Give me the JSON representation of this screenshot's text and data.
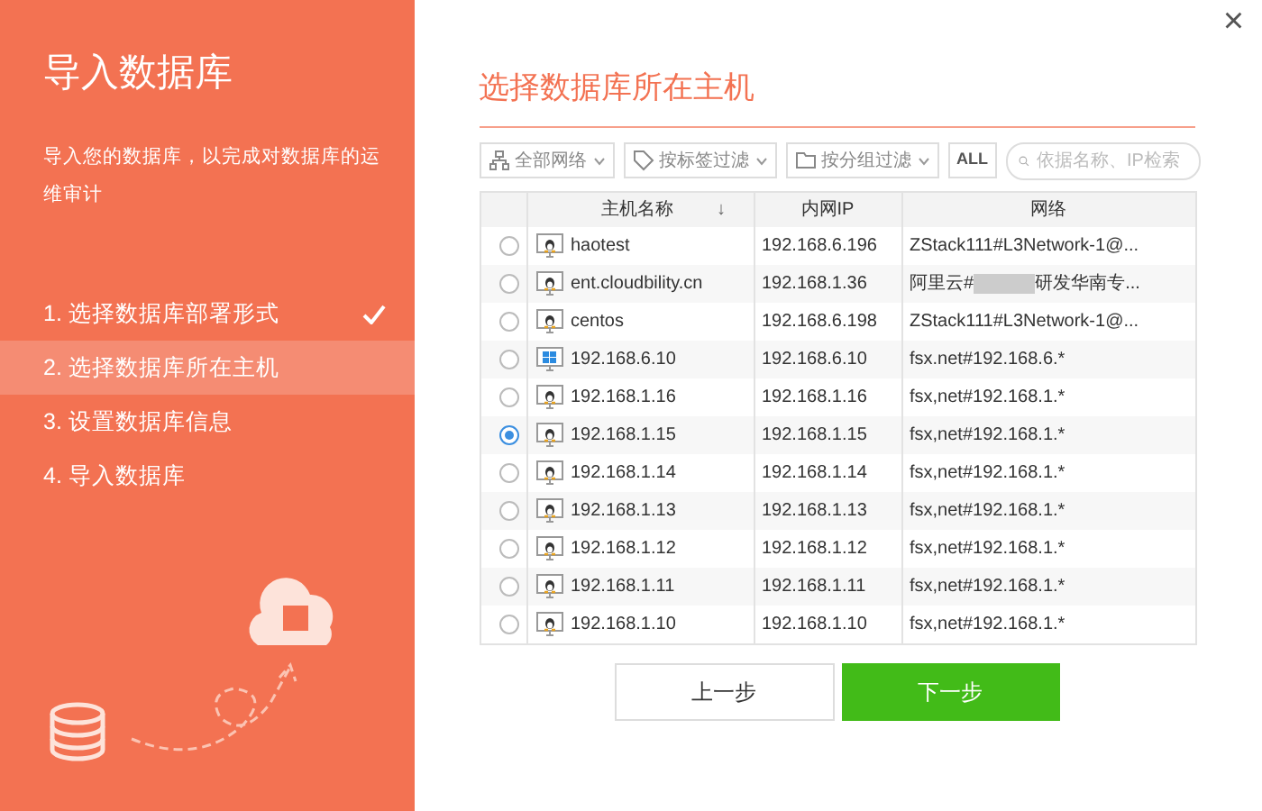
{
  "sidebar": {
    "title": "导入数据库",
    "description": "导入您的数据库，以完成对数据库的运维审计",
    "steps": [
      {
        "label": "1. 选择数据库部署形式",
        "done": true,
        "selected": false
      },
      {
        "label": "2. 选择数据库所在主机",
        "done": false,
        "selected": true
      },
      {
        "label": "3. 设置数据库信息",
        "done": false,
        "selected": false
      },
      {
        "label": "4. 导入数据库",
        "done": false,
        "selected": false
      }
    ]
  },
  "main": {
    "title": "选择数据库所在主机",
    "filters": [
      {
        "kind": "network",
        "label": "全部网络"
      },
      {
        "kind": "tag",
        "label": "按标签过滤"
      },
      {
        "kind": "group",
        "label": "按分组过滤"
      }
    ],
    "all_button": "ALL",
    "search": {
      "placeholder": "依据名称、IP检索"
    },
    "table": {
      "columns": [
        {
          "label": "主机名称",
          "sorted": true,
          "sort_icon": "↓"
        },
        {
          "label": "内网IP",
          "sorted": false
        },
        {
          "label": "网络",
          "sorted": false
        }
      ],
      "rows": [
        {
          "selected": false,
          "kind": "linux",
          "name": "haotest",
          "ip": "192.168.6.196",
          "network": "ZStack111#L3Network-1@..."
        },
        {
          "selected": false,
          "kind": "linux",
          "name": "ent.cloudbility.cn",
          "ip": "192.168.1.36",
          "network": "阿里云#",
          "redacted": true,
          "network_tail": "研发华南专..."
        },
        {
          "selected": false,
          "kind": "linux",
          "name": "centos",
          "ip": "192.168.6.198",
          "network": "ZStack111#L3Network-1@..."
        },
        {
          "selected": false,
          "kind": "windows",
          "name": "192.168.6.10",
          "ip": "192.168.6.10",
          "network": "fsx.net#192.168.6.*"
        },
        {
          "selected": false,
          "kind": "linux",
          "name": "192.168.1.16",
          "ip": "192.168.1.16",
          "network": "fsx,net#192.168.1.*"
        },
        {
          "selected": true,
          "kind": "linux",
          "name": "192.168.1.15",
          "ip": "192.168.1.15",
          "network": "fsx,net#192.168.1.*"
        },
        {
          "selected": false,
          "kind": "linux",
          "name": "192.168.1.14",
          "ip": "192.168.1.14",
          "network": "fsx,net#192.168.1.*"
        },
        {
          "selected": false,
          "kind": "linux",
          "name": "192.168.1.13",
          "ip": "192.168.1.13",
          "network": "fsx,net#192.168.1.*"
        },
        {
          "selected": false,
          "kind": "linux",
          "name": "192.168.1.12",
          "ip": "192.168.1.12",
          "network": "fsx,net#192.168.1.*"
        },
        {
          "selected": false,
          "kind": "linux",
          "name": "192.168.1.11",
          "ip": "192.168.1.11",
          "network": "fsx,net#192.168.1.*"
        },
        {
          "selected": false,
          "kind": "linux",
          "name": "192.168.1.10",
          "ip": "192.168.1.10",
          "network": "fsx,net#192.168.1.*"
        }
      ]
    },
    "buttons": [
      {
        "kind": "secondary",
        "label": "上一步"
      },
      {
        "kind": "primary",
        "label": "下一步"
      }
    ]
  },
  "close_button": "×"
}
